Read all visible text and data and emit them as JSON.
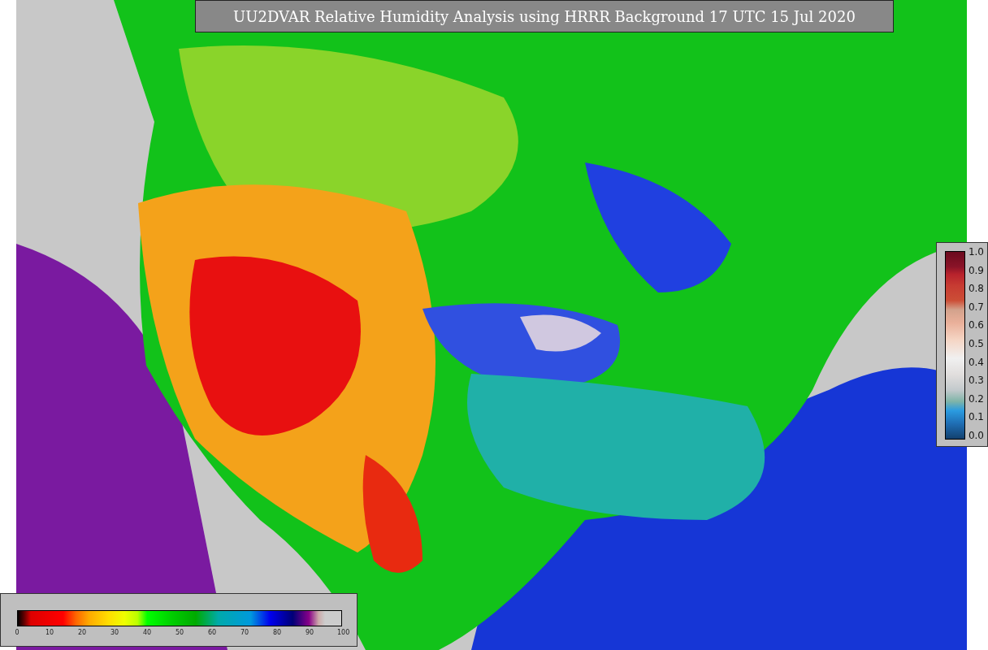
{
  "title": "UU2DVAR Relative Humidity Analysis using HRRR Background 17 UTC 15 Jul 2020",
  "colorbar_fraction": {
    "ticks": [
      "1.0",
      "0.9",
      "0.8",
      "0.7",
      "0.6",
      "0.5",
      "0.4",
      "0.3",
      "0.2",
      "0.1",
      "0.0"
    ]
  },
  "colorbar_percent": {
    "ticks": [
      "0",
      "10",
      "20",
      "30",
      "40",
      "50",
      "60",
      "70",
      "80",
      "90",
      "100"
    ]
  }
}
